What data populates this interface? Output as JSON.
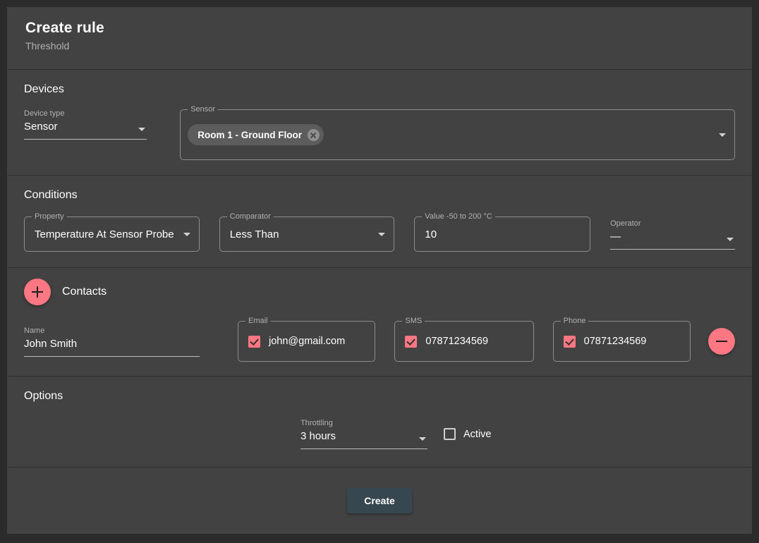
{
  "header": {
    "title": "Create rule",
    "subtitle": "Threshold"
  },
  "devices": {
    "section_title": "Devices",
    "device_type": {
      "label": "Device type",
      "value": "Sensor"
    },
    "sensor": {
      "label": "Sensor",
      "chips": [
        {
          "label": "Room 1 - Ground Floor",
          "remove_icon": "close-circle-icon"
        }
      ]
    }
  },
  "conditions": {
    "section_title": "Conditions",
    "property": {
      "label": "Property",
      "value": "Temperature At Sensor Probe"
    },
    "comparator": {
      "label": "Comparator",
      "value": "Less Than"
    },
    "value": {
      "label": "Value -50 to 200 °C",
      "value": "10"
    },
    "operator": {
      "label": "Operator",
      "value": "—"
    }
  },
  "contacts": {
    "section_title": "Contacts",
    "add_icon": "plus-icon",
    "remove_icon": "minus-icon",
    "rows": [
      {
        "name": {
          "label": "Name",
          "value": "John Smith"
        },
        "email": {
          "label": "Email",
          "value": "john@gmail.com",
          "checked": true
        },
        "sms": {
          "label": "SMS",
          "value": "07871234569",
          "checked": true
        },
        "phone": {
          "label": "Phone",
          "value": "07871234569",
          "checked": true
        }
      }
    ]
  },
  "options": {
    "section_title": "Options",
    "throttling": {
      "label": "Throttling",
      "value": "3 hours"
    },
    "active": {
      "label": "Active",
      "checked": false
    }
  },
  "footer": {
    "create_label": "Create"
  },
  "colors": {
    "page_background": "#2b2b2b",
    "card_background": "#424242",
    "accent": "#ff7782",
    "create_button": "#37474f",
    "chip_background": "#5c5c5c",
    "divider": "#303030"
  }
}
